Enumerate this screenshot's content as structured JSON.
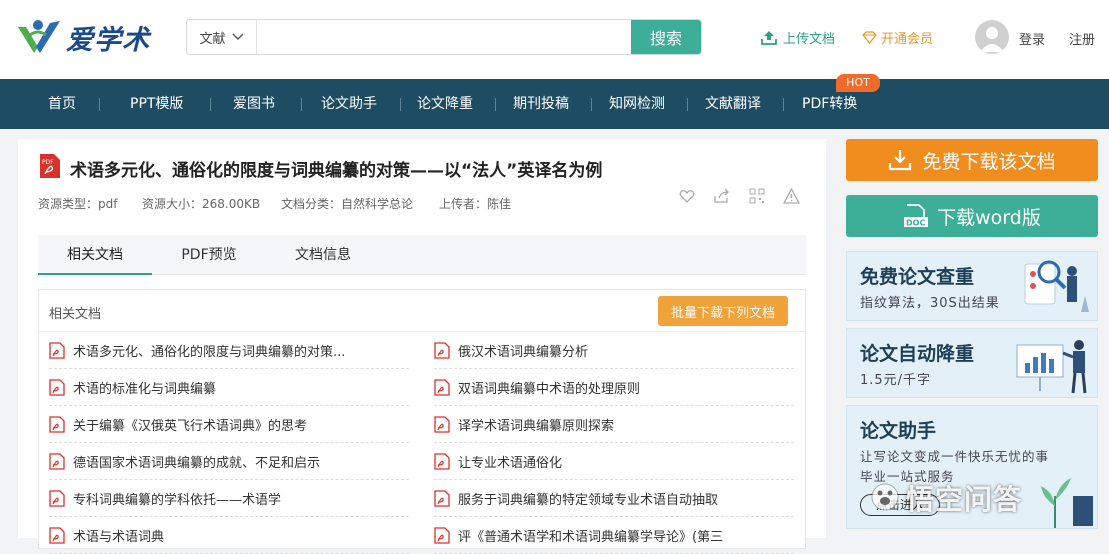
{
  "header": {
    "logo_text": "爱学术",
    "search": {
      "type_label": "文献",
      "value": "",
      "placeholder": "",
      "button_label": "搜索"
    },
    "upload_label": "上传文档",
    "vip_label": "开通会员",
    "login_label": "登录",
    "register_label": "注册"
  },
  "nav": {
    "items": [
      "首页",
      "PPT模版",
      "爱图书",
      "论文助手",
      "论文降重",
      "期刊投稿",
      "知网检测",
      "文献翻译",
      "PDF转换"
    ],
    "hot_badge": "HOT"
  },
  "document": {
    "title": "术语多元化、通俗化的限度与词典编纂的对策——以“法人”英译名为例",
    "meta": {
      "type": "资源类型：pdf",
      "size": "资源大小：268.00KB",
      "category": "文档分类：自然科学总论",
      "uploader": "上传者：陈佳"
    },
    "actions": [
      "heart-icon",
      "share-icon",
      "qrcode-icon",
      "warning-icon"
    ]
  },
  "tabs": [
    "相关文档",
    "PDF预览",
    "文档信息"
  ],
  "related": {
    "label": "相关文档",
    "batch_button": "批量下载下列文档",
    "left": [
      "术语多元化、通俗化的限度与词典编纂的对策...",
      "术语的标准化与词典编纂",
      "关于编纂《汉俄英飞行术语词典》的思考",
      "德语国家术语词典编纂的成就、不足和启示",
      "专科词典编纂的学科依托——术语学",
      "术语与术语词典"
    ],
    "right": [
      "俄汉术语词典编纂分析",
      "双语词典编纂中术语的处理原则",
      "译学术语词典编纂原则探索",
      "让专业术语通俗化",
      "服务于词典编纂的特定领域专业术语自动抽取",
      "评《普通术语学和术语词典编纂学导论》(第三"
    ]
  },
  "sidebar": {
    "download_free": "免费下载该文档",
    "download_word": "下载word版",
    "promo1": {
      "title": "免费论文查重",
      "subtitle": "指纹算法，30S出结果"
    },
    "promo2": {
      "title": "论文自动降重",
      "subtitle": "1.5元/千字"
    },
    "promo3": {
      "title": "论文助手",
      "subtitle1": "让写论文变成一件快乐无忧的事",
      "subtitle2": "毕业一站式服务",
      "button": "点击进入"
    }
  },
  "watermark": "悟空问答",
  "colors": {
    "nav_bg": "#1e4d63",
    "accent_green": "#3dae97",
    "accent_orange": "#f08d1e",
    "hot_badge": "#f06a2b"
  }
}
